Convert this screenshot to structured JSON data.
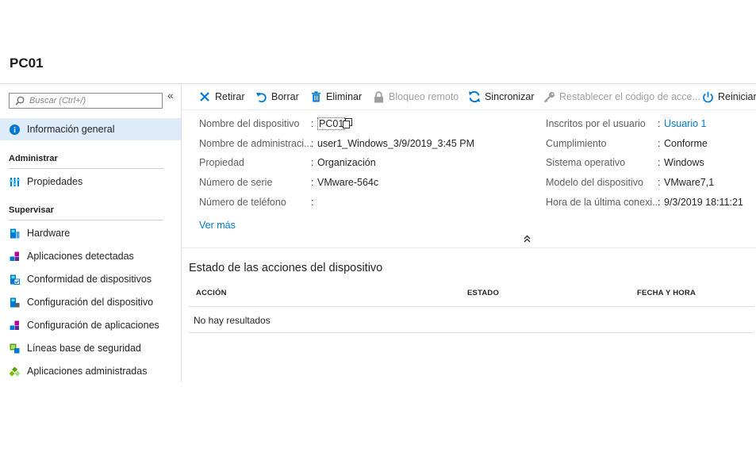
{
  "page": {
    "title": "PC01"
  },
  "sidebar": {
    "collapse_glyph": "«",
    "search_placeholder": "Buscar (Ctrl+/)",
    "overview": {
      "label": "Información general",
      "icon": "info-icon"
    },
    "sections": [
      {
        "header": "Administrar",
        "items": [
          {
            "label": "Propiedades",
            "icon": "properties-icon"
          }
        ]
      },
      {
        "header": "Supervisar",
        "items": [
          {
            "label": "Hardware",
            "icon": "hardware-icon"
          },
          {
            "label": "Aplicaciones detectadas",
            "icon": "apps-icon"
          },
          {
            "label": "Conformidad de dispositivos",
            "icon": "compliance-icon"
          },
          {
            "label": "Configuración del dispositivo",
            "icon": "device-config-icon"
          },
          {
            "label": "Configuración de aplicaciones",
            "icon": "app-config-icon"
          },
          {
            "label": "Líneas base de seguridad",
            "icon": "security-baseline-icon"
          },
          {
            "label": "Aplicaciones administradas",
            "icon": "managed-apps-icon"
          }
        ]
      }
    ]
  },
  "toolbar": {
    "retire": "Retirar",
    "wipe": "Borrar",
    "delete": "Eliminar",
    "remote_lock": "Bloqueo remoto",
    "sync": "Sincronizar",
    "reset_passcode": "Restablecer el código de acce...",
    "restart": "Reiniciar"
  },
  "essentials": {
    "left": [
      {
        "label": "Nombre del dispositivo",
        "value": "PC01"
      },
      {
        "label": "Nombre de administraci...",
        "value": "user1_Windows_3/9/2019_3:45 PM"
      },
      {
        "label": "Propiedad",
        "value": "Organización"
      },
      {
        "label": "Número de serie",
        "value": "VMware-564c"
      },
      {
        "label": "Número de teléfono",
        "value": ""
      }
    ],
    "right": [
      {
        "label": "Inscritos por el usuario",
        "value": "Usuario 1"
      },
      {
        "label": "Cumplimiento",
        "value": "Conforme"
      },
      {
        "label": "Sistema operativo",
        "value": "Windows"
      },
      {
        "label": "Modelo del dispositivo",
        "value": "VMware7,1"
      },
      {
        "label": "Hora de la última conexi...",
        "value": "9/3/2019 18:11:21"
      }
    ],
    "separator": ":",
    "see_more": "Ver más",
    "collapse_glyph": "⌃"
  },
  "actions_status": {
    "title": "Estado de las acciones del dispositivo",
    "columns": [
      "ACCIÓN",
      "ESTADO",
      "FECHA Y HORA"
    ],
    "empty_text": "No hay resultados"
  },
  "colors": {
    "accent": "#0078d4",
    "selected_bg": "#deecf9",
    "disabled": "#a19f9d"
  }
}
